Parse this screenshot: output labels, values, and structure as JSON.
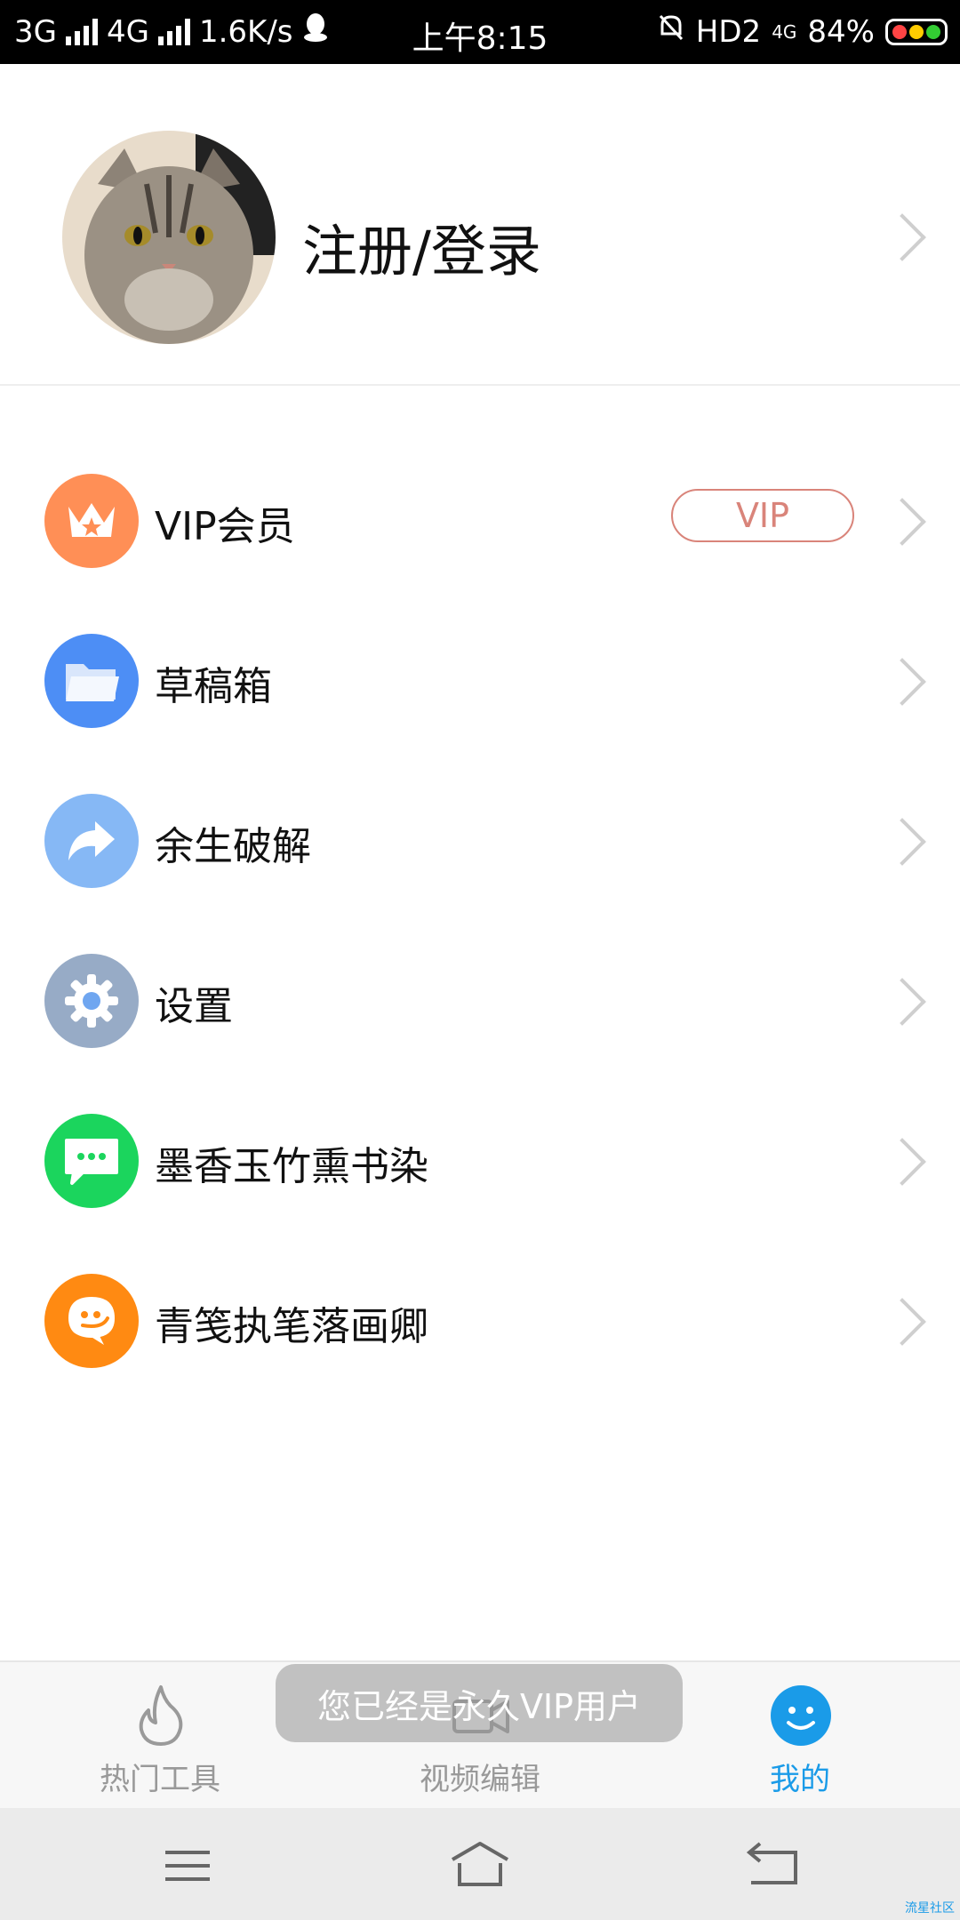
{
  "status_bar": {
    "net1": "3G",
    "net2": "4G",
    "speed": "1.6K/s",
    "time": "上午8:15",
    "hd": "HD2",
    "net3": "4G",
    "battery": "84%"
  },
  "profile": {
    "login_label": "注册/登录"
  },
  "menu": {
    "items": [
      {
        "label": "VIP会员",
        "badge": "VIP",
        "icon": "crown-icon",
        "color": "#ff8f56"
      },
      {
        "label": "草稿箱",
        "icon": "folder-icon",
        "color": "#4d8ef5"
      },
      {
        "label": "余生破解",
        "icon": "share-arrow-icon",
        "color": "#86b8f5"
      },
      {
        "label": "设置",
        "icon": "gear-icon",
        "color": "#97abc6"
      },
      {
        "label": "墨香玉竹熏书染",
        "icon": "chat-bubble-icon",
        "color": "#1bd55d"
      },
      {
        "label": "青笺执笔落画卿",
        "icon": "face-bubble-icon",
        "color": "#ff8a12"
      }
    ]
  },
  "tabs": [
    {
      "label": "热门工具",
      "icon": "flame-icon",
      "active": false
    },
    {
      "label": "视频编辑",
      "icon": "video-camera-icon",
      "active": false
    },
    {
      "label": "我的",
      "icon": "smiley-icon",
      "active": true
    }
  ],
  "toast": "您已经是永久VIP用户",
  "colors": {
    "accent": "#1a9be8",
    "vip": "#d9847a"
  },
  "watermark": "流星社区"
}
